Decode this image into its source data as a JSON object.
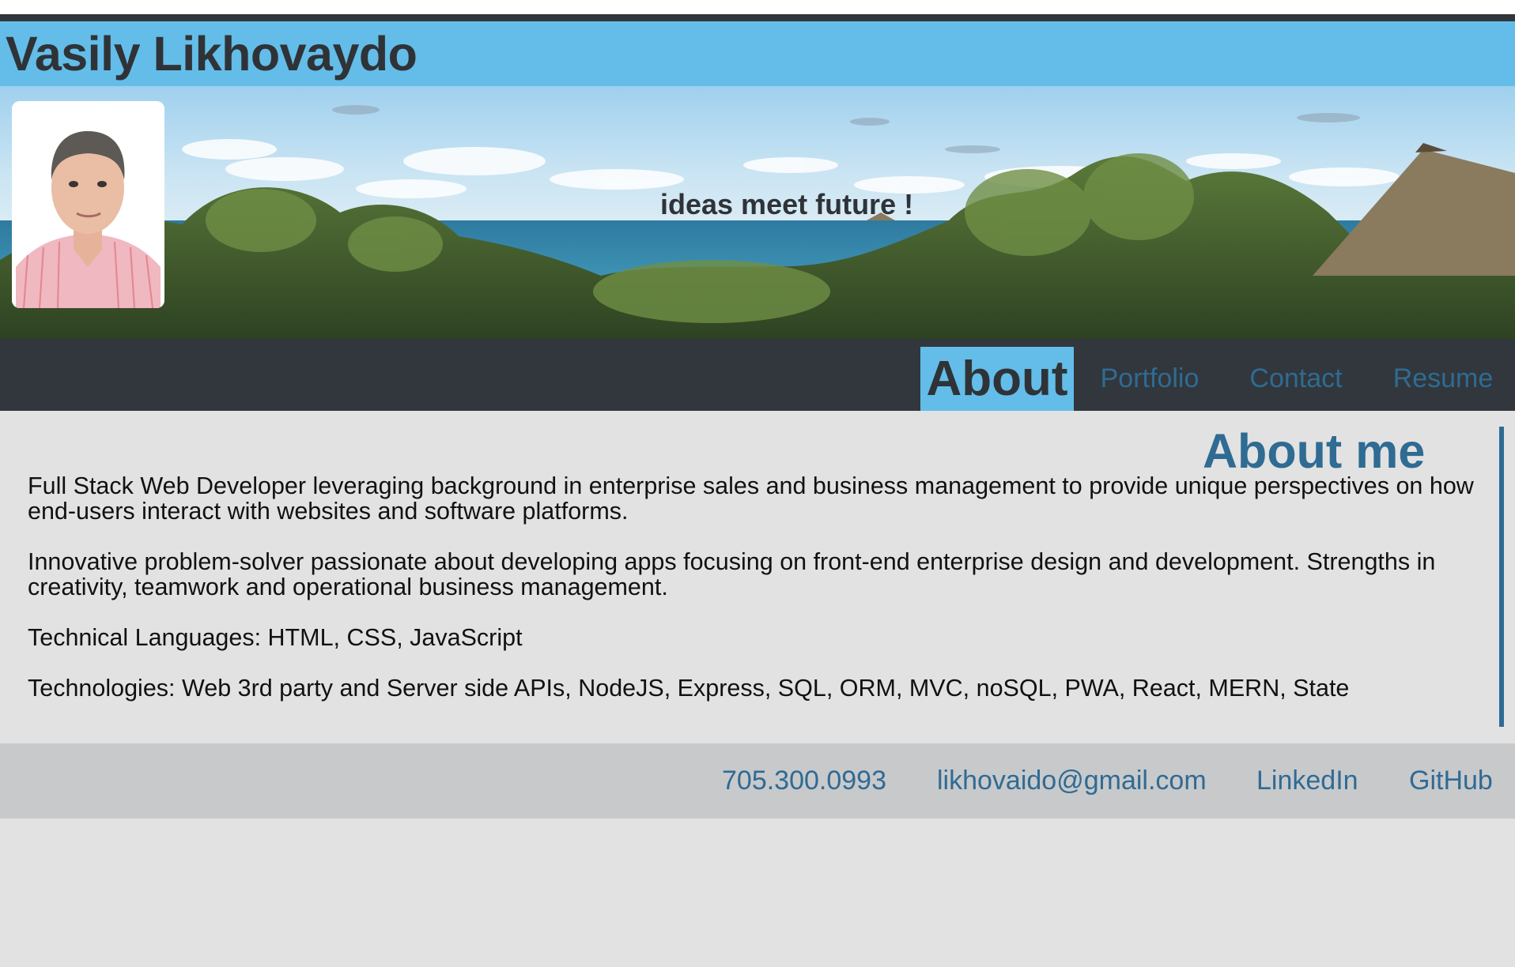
{
  "header": {
    "site_title": "Vasily Likhovaydo",
    "tagline": "ideas meet future !"
  },
  "nav": {
    "items": [
      {
        "label": "About",
        "active": true
      },
      {
        "label": "Portfolio",
        "active": false
      },
      {
        "label": "Contact",
        "active": false
      },
      {
        "label": "Resume",
        "active": false
      }
    ]
  },
  "about": {
    "title": "About me",
    "paragraphs": [
      "Full Stack Web Developer leveraging background in enterprise sales and business management to provide unique perspectives on how end-users interact with websites and software platforms.",
      "Innovative problem-solver passionate about developing apps focusing on front-end enterprise design and development. Strengths in creativity, teamwork and operational business management.",
      "Technical Languages: HTML, CSS, JavaScript",
      "Technologies: Web 3rd party and Server side APIs, NodeJS, Express, SQL, ORM, MVC, noSQL, PWA, React, MERN, State"
    ]
  },
  "footer": {
    "phone": "705.300.0993",
    "email": "likhovaido@gmail.com",
    "linkedin": "LinkedIn",
    "github": "GitHub"
  },
  "colors": {
    "accent_blue": "#63bde8",
    "dark": "#31373c",
    "link_blue": "#2f6b93",
    "page_bg": "#e2e2e2",
    "footer_bg": "#c8c9cb"
  }
}
